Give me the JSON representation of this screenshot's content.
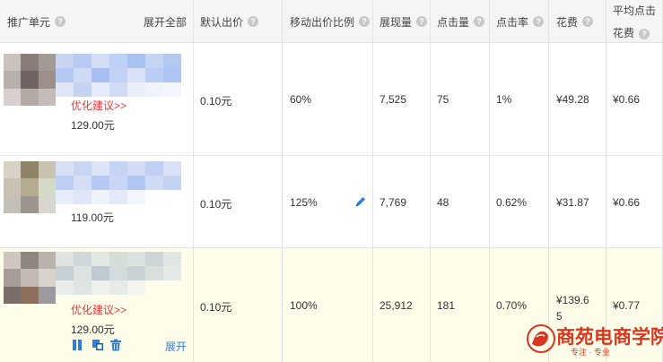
{
  "header": {
    "unit": "推广单元",
    "expand_all": "展开全部",
    "default_bid": "默认出价",
    "mobile_ratio": "移动出价比例",
    "impressions": "展现量",
    "clicks": "点击量",
    "ctr": "点击率",
    "cost": "花费",
    "avg_cpc_line1": "平均点击",
    "avg_cpc_line2": "花费",
    "help_glyph": "?"
  },
  "rows": [
    {
      "suggestion": "优化建议>>",
      "price": "129.00元",
      "default_bid": "0.10元",
      "mobile_ratio": "60%",
      "impressions": "7,525",
      "clicks": "75",
      "ctr": "1%",
      "cost": "¥49.28",
      "avg_cpc": "¥0.66"
    },
    {
      "suggestion": "",
      "price": "119.00元",
      "default_bid": "0.10元",
      "mobile_ratio": "125%",
      "impressions": "7,769",
      "clicks": "48",
      "ctr": "0.62%",
      "cost": "¥31.87",
      "avg_cpc": "¥0.66"
    },
    {
      "suggestion": "优化建议>>",
      "price": "129.00元",
      "default_bid": "0.10元",
      "mobile_ratio": "100%",
      "impressions": "25,912",
      "clicks": "181",
      "ctr": "0.70%",
      "cost_line1": "¥139.6",
      "cost_line2": "5",
      "avg_cpc": "¥0.77",
      "expand": "展开"
    }
  ],
  "icons": {
    "edit": "pencil-icon",
    "pause": "pause-icon",
    "copy": "copy-icon",
    "delete": "trash-icon"
  },
  "watermark": {
    "title": "商苑电商学院",
    "subtitle": "专注 · 专业"
  },
  "colors": {
    "header_bg": "#f5f5f5",
    "highlight_row": "#fdfde9",
    "suggestion": "#e4393c",
    "link": "#3a7bd5",
    "brand": "#d8361f"
  }
}
